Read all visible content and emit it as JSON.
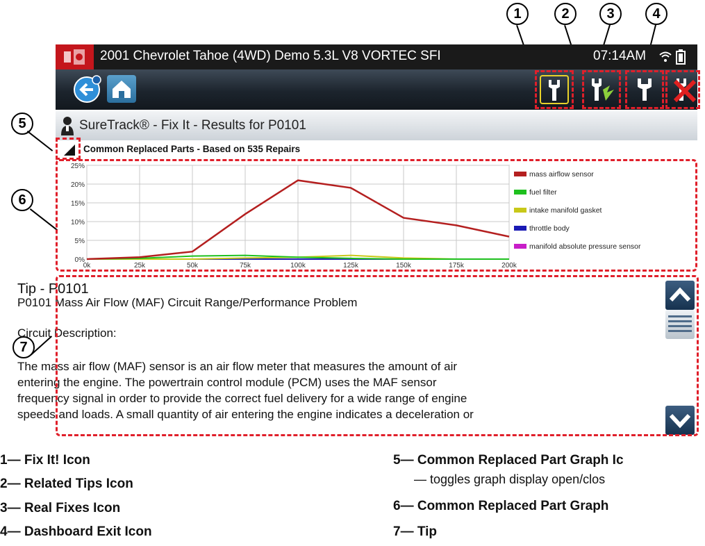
{
  "status_bar": {
    "vehicle": "2001 Chevrolet Tahoe (4WD) Demo 5.3L V8 VORTEC SFI",
    "time": "07:14AM",
    "logo_icon": "snapon-logo-icon",
    "wifi_icon": "wifi-icon",
    "battery_icon": "battery-icon"
  },
  "toolbar": {
    "back_icon": "back-arrow-icon",
    "home_icon": "home-icon",
    "fix_it_icon": "fix-it-wrench-icon",
    "related_tips_icon": "related-tips-icon",
    "real_fixes_icon": "real-fixes-wrench-icon",
    "exit_icon": "dashboard-exit-icon"
  },
  "header": {
    "title": "SureTrack® - Fix It - Results for P0101",
    "section_label": "Common Replaced Parts - Based on 535 Repairs"
  },
  "chart_data": {
    "type": "line",
    "x": [
      0,
      25000,
      50000,
      75000,
      100000,
      125000,
      150000,
      175000,
      200000
    ],
    "x_tick_labels": [
      "0k",
      "25k",
      "50k",
      "75k",
      "100k",
      "125k",
      "150k",
      "175k",
      "200k"
    ],
    "y_tick_labels": [
      "0%",
      "5%",
      "10%",
      "15%",
      "20%",
      "25%"
    ],
    "ylim": [
      0,
      25
    ],
    "xlim": [
      0,
      200000
    ],
    "grid": true,
    "legend_position": "right",
    "series": [
      {
        "name": "mass airflow sensor",
        "color": "#b41f1f",
        "values": [
          0,
          0.5,
          2,
          12,
          21,
          19,
          11,
          9,
          6
        ]
      },
      {
        "name": "fuel filter",
        "color": "#1ec01e",
        "values": [
          0,
          0.2,
          0.8,
          1,
          0.5,
          0.2,
          0,
          0,
          0
        ]
      },
      {
        "name": "intake manifold gasket",
        "color": "#c8c819",
        "values": [
          0,
          0,
          0,
          0.3,
          0.5,
          1,
          0.3,
          0,
          0
        ]
      },
      {
        "name": "throttle body",
        "color": "#1a1ab4",
        "values": [
          0,
          0,
          0,
          0,
          0,
          0,
          0,
          0,
          0
        ]
      },
      {
        "name": "manifold absolute pressure sensor",
        "color": "#c81ec8",
        "values": [
          0,
          0,
          0,
          0,
          0,
          0,
          0,
          0,
          0
        ]
      }
    ]
  },
  "tip": {
    "title": "Tip - P0101",
    "heading": "P0101 Mass Air Flow (MAF) Circuit Range/Performance Problem",
    "circuit_label": "Circuit Description:",
    "lines": [
      "The mass air flow (MAF) sensor is an air flow meter that measures the amount of air",
      "entering the engine. The powertrain control module (PCM) uses the MAF sensor",
      "frequency signal in order to provide the correct fuel delivery for a wide range of engine",
      "speeds and loads. A small quantity of air entering the engine indicates a deceleration or"
    ],
    "scroll_up_icon": "chevron-up-icon",
    "scroll_thumb_icon": "scroll-thumb-icon",
    "scroll_down_icon": "chevron-down-icon"
  },
  "callouts": [
    "1",
    "2",
    "3",
    "4",
    "5",
    "6",
    "7"
  ],
  "legend_items": [
    {
      "num": "1",
      "text": "1— Fix It! Icon"
    },
    {
      "num": "2",
      "text": "2— Related Tips Icon"
    },
    {
      "num": "3",
      "text": "3— Real Fixes Icon"
    },
    {
      "num": "4",
      "text": "4— Dashboard Exit Icon"
    },
    {
      "num": "5",
      "text": "5— Common Replaced Part Graph Ic",
      "sub": "— toggles graph display open/clos"
    },
    {
      "num": "6",
      "text": "6— Common Replaced Part Graph"
    },
    {
      "num": "7",
      "text": "7— Tip"
    }
  ],
  "accent_color": "#e01f2a"
}
